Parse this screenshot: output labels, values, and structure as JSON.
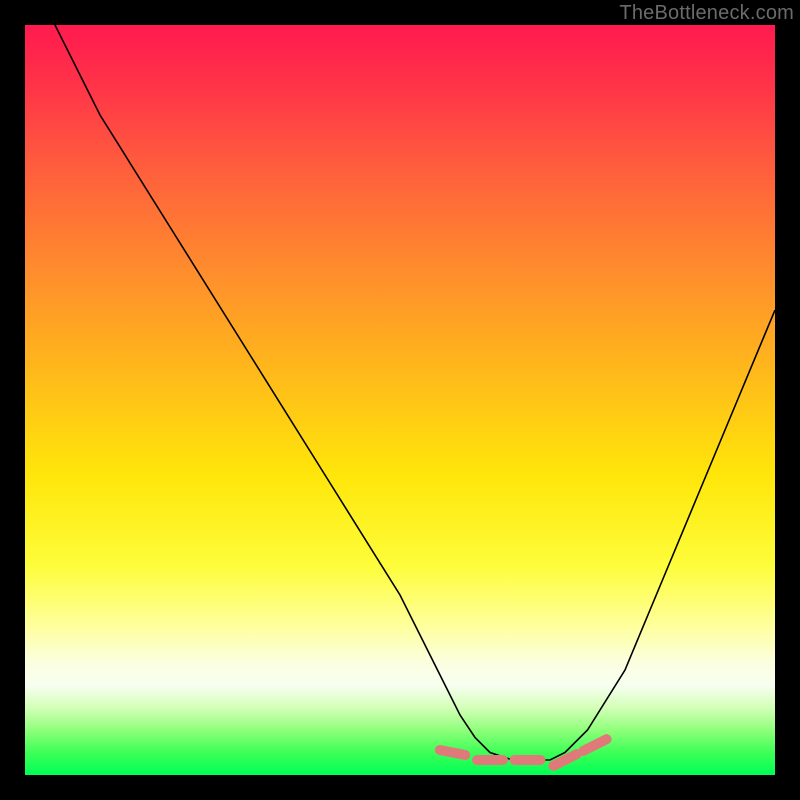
{
  "watermark": "TheBottleneck.com",
  "colors": {
    "gradient_top": "#ff1a4f",
    "gradient_mid": "#ffe60a",
    "gradient_bottom": "#00ff55",
    "curve": "#000000",
    "markers": "#e07a7a",
    "frame": "#000000"
  },
  "chart_data": {
    "type": "line",
    "title": "",
    "xlabel": "",
    "ylabel": "",
    "xlim": [
      0,
      100
    ],
    "ylim": [
      0,
      100
    ],
    "grid": false,
    "legend": false,
    "series": [
      {
        "name": "bottleneck-curve",
        "x": [
          4,
          10,
          20,
          30,
          40,
          50,
          55,
          58,
          60,
          62,
          65,
          68,
          70,
          72,
          75,
          80,
          85,
          90,
          95,
          100
        ],
        "y": [
          100,
          88,
          72,
          56,
          40,
          24,
          14,
          8,
          5,
          3,
          2,
          2,
          2,
          3,
          6,
          14,
          26,
          38,
          50,
          62
        ]
      }
    ],
    "annotations": [
      {
        "name": "optimal-range-markers",
        "style": "capsule",
        "x": [
          57,
          62,
          67,
          72,
          76
        ],
        "y": [
          3,
          2,
          2,
          2,
          4
        ]
      }
    ]
  }
}
